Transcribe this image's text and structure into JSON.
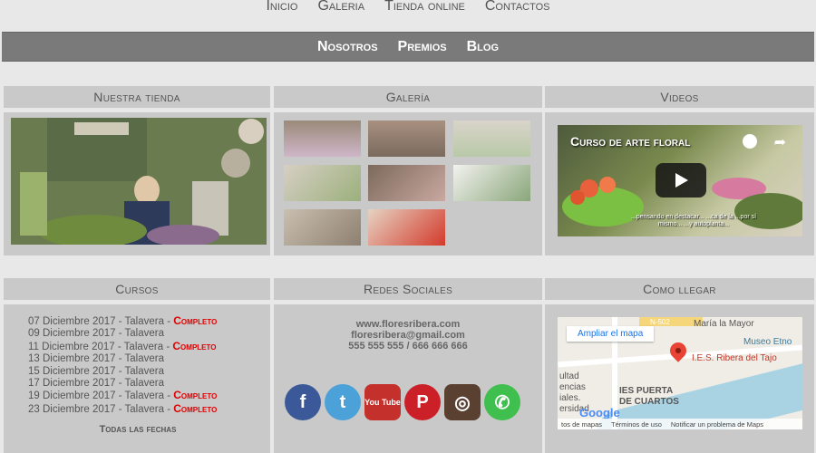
{
  "topnav": [
    "Inicio",
    "Galeria",
    "Tienda online",
    "Contactos"
  ],
  "subnav": [
    "Nosotros",
    "Premios",
    "Blog"
  ],
  "sections": {
    "tienda": "Nuestra tienda",
    "galeria": "Galería",
    "videos": "Videos",
    "cursos": "Cursos",
    "redes": "Redes Sociales",
    "llegar": "Como llegar"
  },
  "video": {
    "title": "Curso de arte floral",
    "caption": "...pensando en destacar... ...ca de la ...por sí mismo... ...y autoplanta..."
  },
  "courses": [
    {
      "date": "07 Diciembre 2017 - Talavera",
      "status": "Completo"
    },
    {
      "date": "09 Diciembre 2017 - Talavera",
      "status": ""
    },
    {
      "date": "11 Diciembre 2017 - Talavera",
      "status": "Completo"
    },
    {
      "date": "13 Diciembre 2017 - Talavera",
      "status": ""
    },
    {
      "date": "15 Diciembre 2017 - Talavera",
      "status": ""
    },
    {
      "date": "17 Diciembre 2017 - Talavera",
      "status": ""
    },
    {
      "date": "19 Diciembre 2017 - Talavera",
      "status": "Completo"
    },
    {
      "date": "23 Diciembre 2017 - Talavera",
      "status": "Completo"
    }
  ],
  "courses_separator": " - ",
  "all_dates": "Todas las fechas",
  "contact": {
    "web": "www.floresribera.com",
    "email": "floresribera@gmail.com",
    "phones": "555 555 555 / 666 666 666"
  },
  "social": [
    {
      "name": "facebook-icon",
      "label": "f",
      "color": "#3b5998"
    },
    {
      "name": "twitter-icon",
      "label": "t",
      "color": "#4ca2d8"
    },
    {
      "name": "youtube-icon",
      "label": "You Tube",
      "color": "#c4302b"
    },
    {
      "name": "pinterest-icon",
      "label": "P",
      "color": "#cb2027"
    },
    {
      "name": "instagram-icon",
      "label": "◎",
      "color": "#5a4031"
    },
    {
      "name": "whatsapp-icon",
      "label": "✆",
      "color": "#3fbf4e"
    }
  ],
  "map": {
    "ampliar": "Ampliar el mapa",
    "place": "I.E.S. Ribera del Tajo",
    "labels": [
      "N-502",
      "María la Mayor",
      "Museo Etno",
      "IES PUERTA",
      "DE CUARTOS",
      "ultad",
      "encias",
      "iales.",
      "ersidad"
    ],
    "footer": [
      "tos de mapas",
      "Términos de uso",
      "Notificar un problema de Maps"
    ],
    "brand": "Google"
  }
}
